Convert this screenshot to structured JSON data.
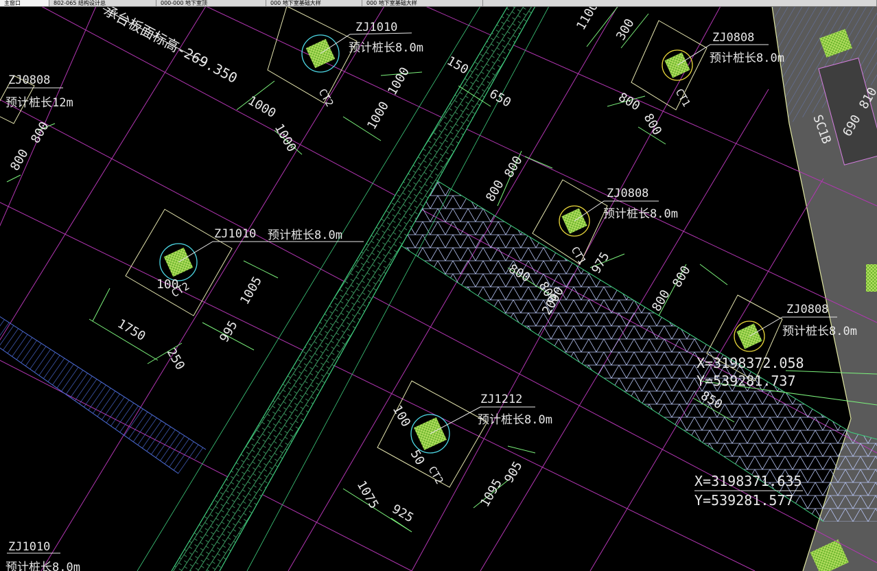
{
  "tabs": [
    {
      "label": "主窗口"
    },
    {
      "label": "802-065 结构设计总"
    },
    {
      "label": "000-000 地下室顶"
    },
    {
      "label": "000 地下室基础大样"
    },
    {
      "label": "000 地下室基础大样"
    }
  ],
  "drawing": {
    "top_note": "承台板面标高-269.350",
    "coordinates": [
      {
        "x": "X=3198372.058",
        "y": "Y=539281.737"
      },
      {
        "x": "X=3198371.635",
        "y": "Y=539281.577"
      }
    ],
    "piles": [
      {
        "id": "ZJ1010",
        "note": "预计桩长8.0m",
        "cap": "CT2"
      },
      {
        "id": "ZJ0808",
        "note": "预计桩长8.0m",
        "cap": "CT1"
      },
      {
        "id": "ZJ0808",
        "note": "预计桩长8.0m",
        "cap": "CT1"
      },
      {
        "id": "ZJ1010",
        "note": "预计桩长8.0m",
        "cap": "CT2"
      },
      {
        "id": "ZJ0808",
        "note": "预计桩长8.0m",
        "cap": ""
      },
      {
        "id": "ZJ1212",
        "note": "预计桩长8.0m",
        "cap": "CT2"
      },
      {
        "id": "ZJ0808",
        "note": "预计桩长12m",
        "cap": ""
      },
      {
        "id": "ZJ1010",
        "note": "预计桩长8.0m",
        "cap": ""
      }
    ],
    "dimensions": {
      "d1": "1000",
      "d2": "1000",
      "d3": "1000",
      "d4": "1000",
      "d5": "150",
      "d6": "650",
      "d7": "1100",
      "d8": "300",
      "d9": "800",
      "d10": "800",
      "d11": "800",
      "d12": "800",
      "d13": "800",
      "d14": "800",
      "d15": "975",
      "d16": "800",
      "d17": "800",
      "d18": "2000",
      "d19": "800",
      "d20": "800",
      "d21": "100",
      "d22": "1005",
      "d23": "1750",
      "d24": "250",
      "d25": "995",
      "d26": "100",
      "d27": "50",
      "d28": "1075",
      "d29": "925",
      "d30": "1095",
      "d31": "905",
      "d32": "850",
      "d33": "800",
      "d34": "800",
      "d35": "SC1B",
      "d36": "690",
      "d37": "810"
    }
  }
}
